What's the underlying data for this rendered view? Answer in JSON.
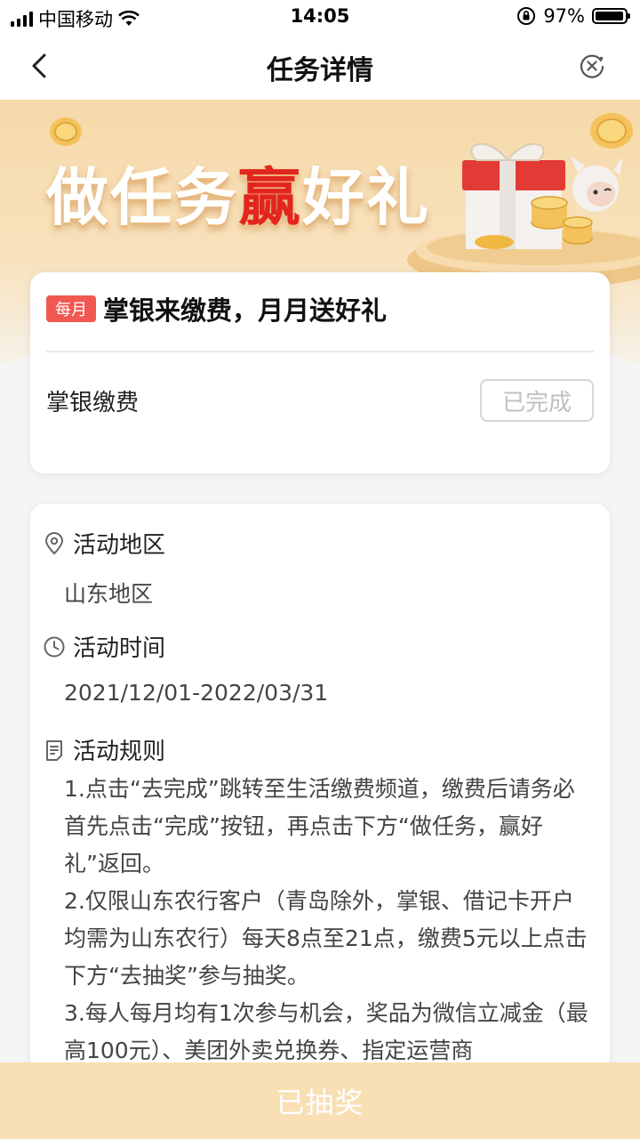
{
  "status_bar": {
    "carrier": "中国移动",
    "time": "14:05",
    "battery": "97%",
    "battery_level": 0.97
  },
  "nav": {
    "title": "任务详情",
    "back_icon": "chevron-left-icon",
    "close_icon": "close-circle-icon"
  },
  "banner": {
    "title_part1": "做任务",
    "title_highlight": "赢",
    "title_part2": "好礼",
    "highlight_color": "#e2261f"
  },
  "task": {
    "tag": "每月",
    "title": "掌银来缴费，月月送好礼",
    "name": "掌银缴费",
    "status_button": "已完成"
  },
  "details": {
    "region_label": "活动地区",
    "region_value": "山东地区",
    "time_label": "活动时间",
    "time_value": "2021/12/01-2022/03/31",
    "rules_label": "活动规则",
    "rules": [
      "1.点击“去完成”跳转至生活缴费频道，缴费后请务必首先点击“完成”按钮，再点击下方“做任务，赢好礼”返回。",
      "2.仅限山东农行客户（青岛除外，掌银、借记卡开户均需为山东农行）每天8点至21点，缴费5元以上点击下方“去抽奖”参与抽奖。",
      "3.每人每月均有1次参与机会，奖品为微信立减金（最高100元）、美团外卖兑换券、指定运营商"
    ]
  },
  "bottom_button": "已抽奖",
  "colors": {
    "tag_bg": "#f1584f",
    "bottom_button_bg": "#f8dfb4",
    "banner_bg": "#f6d9a9"
  }
}
